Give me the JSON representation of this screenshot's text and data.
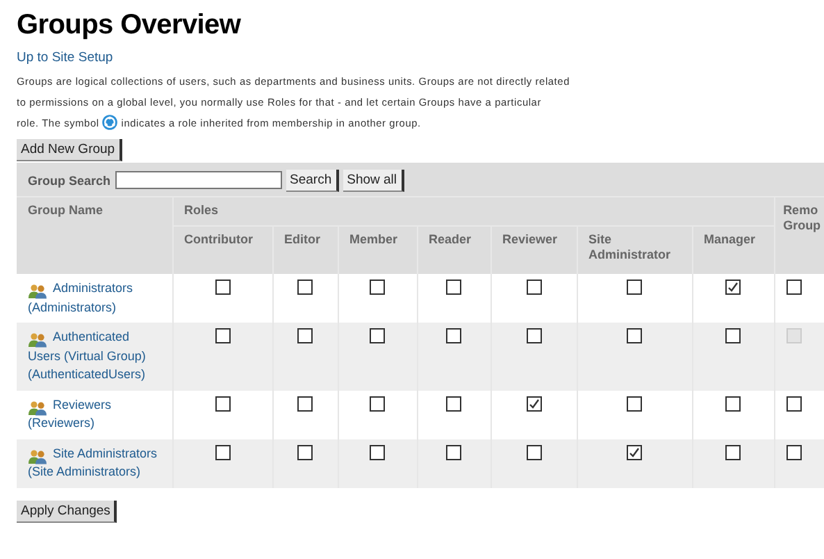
{
  "title": "Groups Overview",
  "up_link": "Up to Site Setup",
  "description": {
    "lines": [
      "Groups are logical collections of users, such as departments and business units. Groups are not directly related",
      "to permissions on a global level, you normally use Roles for that - and let certain Groups have a particular"
    ],
    "before": "role. The symbol",
    "after": "indicates a role inherited from membership in another group."
  },
  "add_button": "Add New Group",
  "search": {
    "label": "Group Search",
    "button": "Search",
    "show_all": "Show all"
  },
  "table": {
    "group_name_header": "Group Name",
    "roles_header": "Roles",
    "remove_header": "Remo Group",
    "roles": [
      "Contributor",
      "Editor",
      "Member",
      "Reader",
      "Reviewer",
      "Site Administrator",
      "Manager"
    ],
    "rows": [
      {
        "name": "Administrators (Administrators)",
        "roles": [
          {
            "checked": false
          },
          {
            "checked": false
          },
          {
            "checked": false
          },
          {
            "checked": false
          },
          {
            "checked": false
          },
          {
            "checked": false
          },
          {
            "checked": true
          }
        ],
        "remove": {
          "checked": false,
          "disabled": false
        }
      },
      {
        "name": "Authenticated Users (Virtual Group) (AuthenticatedUsers)",
        "roles": [
          {
            "checked": false
          },
          {
            "checked": false
          },
          {
            "checked": false
          },
          {
            "checked": false
          },
          {
            "checked": false
          },
          {
            "checked": false
          },
          {
            "checked": false
          }
        ],
        "remove": {
          "checked": false,
          "disabled": true
        }
      },
      {
        "name": "Reviewers (Reviewers)",
        "roles": [
          {
            "checked": false
          },
          {
            "checked": false
          },
          {
            "checked": false
          },
          {
            "checked": false
          },
          {
            "checked": true
          },
          {
            "checked": false
          },
          {
            "checked": false
          }
        ],
        "remove": {
          "checked": false,
          "disabled": false
        }
      },
      {
        "name": "Site Administrators (Site Administrators)",
        "roles": [
          {
            "checked": false
          },
          {
            "checked": false
          },
          {
            "checked": false
          },
          {
            "checked": false
          },
          {
            "checked": false
          },
          {
            "checked": true
          },
          {
            "checked": false
          }
        ],
        "remove": {
          "checked": false,
          "disabled": false
        }
      }
    ]
  },
  "apply_button": "Apply Changes"
}
